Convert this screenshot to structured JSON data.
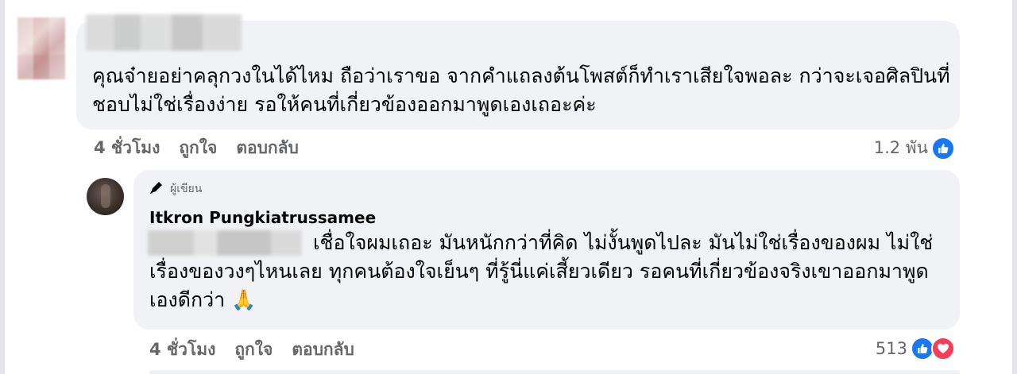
{
  "comment": {
    "text": "คุณจ๋ายอย่าคลุกวงในได้ไหม ถือว่าเราขอ จากคำแถลงต้นโพสต์ก็ทำเราเสียใจพอละ กว่าจะเจอศิลปินที่ชอบไม่ใช่เรื่องง่าย รอให้คนที่เกี่ยวข้องออกมาพูดเองเถอะค่ะ",
    "time": "4 ชั่วโมง",
    "like_label": "ถูกใจ",
    "reply_label": "ตอบกลับ",
    "reaction_count": "1.2 พัน",
    "reaction_icons": [
      "like-icon"
    ]
  },
  "reply": {
    "badge": "ผู้เขียน",
    "badge_icon": "pen-icon",
    "author": "Itkron Pungkiatrussamee",
    "text": "เชื่อใจผมเถอะ มันหนักกว่าที่คิด ไม่งั้นพูดไปละ มันไม่ใช่เรื่องของผม ไม่ใช่เรื่องของวงๆไหนเลย ทุกคนต้องใจเย็นๆ ที่รู้นี่แค่เสี้ยวเดียว รอคนที่เกี่ยวข้องจริงเขาออกมาพูดเองดีกว่า 🙏",
    "time": "4 ชั่วโมง",
    "like_label": "ถูกใจ",
    "reply_label": "ตอบกลับ",
    "reaction_count": "513",
    "reaction_icons": [
      "like-icon",
      "love-icon"
    ]
  },
  "colors": {
    "bubble": "#f0f2f5",
    "meta_text": "#65676b",
    "like_blue": "#1877f2",
    "love_red": "#f33e58"
  }
}
